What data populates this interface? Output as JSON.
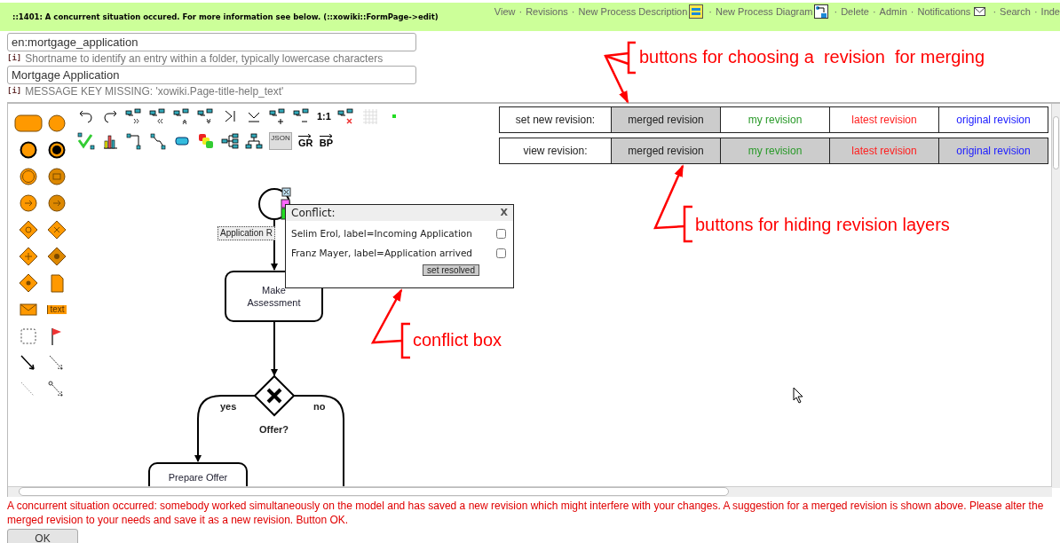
{
  "header": {
    "message": "::1401: A concurrent situation occured. For more information see below. (::xowiki::FormPage->edit)",
    "separator": "·",
    "links": [
      {
        "label": "View"
      },
      {
        "label": "Revisions"
      },
      {
        "label": "New Process Description",
        "kind": "description"
      },
      {
        "label": "New Process Diagram",
        "kind": "diagram"
      },
      {
        "label": "Delete"
      },
      {
        "label": "Admin"
      },
      {
        "label": "Notifications",
        "kind": "mail"
      },
      {
        "label": "Search"
      },
      {
        "label": "Inde"
      }
    ]
  },
  "fields": [
    {
      "value": "en:mortgage_application",
      "info_mark": "[i]",
      "help": "Shortname to identify an entry within a folder, typically lowercase characters"
    },
    {
      "value": "Mortgage Application",
      "info_mark": "[i]",
      "help": "MESSAGE KEY MISSING: 'xowiki.Page-title-help_text'"
    }
  ],
  "toolbar_labels": {
    "fit": "1:1",
    "json": "JSON",
    "gr": "GR",
    "bp": "BP",
    "text_shape": "text"
  },
  "revision_rows": [
    {
      "label": "set new revision:",
      "kind": "choose",
      "buttons": [
        {
          "label": "merged revision",
          "color": "#222222",
          "selected": true
        },
        {
          "label": "my revision",
          "color": "#2a9a2a",
          "selected": false
        },
        {
          "label": "latest revision",
          "color": "#ff2020",
          "selected": false
        },
        {
          "label": "original revision",
          "color": "#2020ff",
          "selected": false
        }
      ]
    },
    {
      "label": "view revision:",
      "kind": "toggle",
      "buttons": [
        {
          "label": "merged revision",
          "color": "#222222",
          "on": true
        },
        {
          "label": "my revision",
          "color": "#2a9a2a",
          "on": true
        },
        {
          "label": "latest revision",
          "color": "#ff2020",
          "on": true
        },
        {
          "label": "original revision",
          "color": "#2020ff",
          "on": true
        }
      ]
    }
  ],
  "diagram": {
    "start_label": "Application R",
    "tasks": [
      {
        "label": "Make Assessment"
      },
      {
        "label": "Prepare Offer"
      }
    ],
    "gateway": {
      "label": "Offer?",
      "branches": [
        "yes",
        "no"
      ]
    }
  },
  "conflict": {
    "title": "Conflict:",
    "close": "X",
    "items": [
      {
        "text": "Selim Erol, label=Incoming Application",
        "checked": false
      },
      {
        "text": "Franz Mayer, label=Application arrived",
        "checked": false
      }
    ],
    "button": "set resolved"
  },
  "annotations": [
    "buttons for choosing a  revision  for merging",
    "buttons for hiding revision layers",
    "conflict box"
  ],
  "footer": {
    "error": "A concurrent situation occurred: somebody worked simultaneously on the model and has saved a new revision which might interfere with your changes. A suggestion for a merged revision is shown above. Please alter the merged revision to your needs and save it as a new revision. Button OK.",
    "ok": "OK"
  }
}
